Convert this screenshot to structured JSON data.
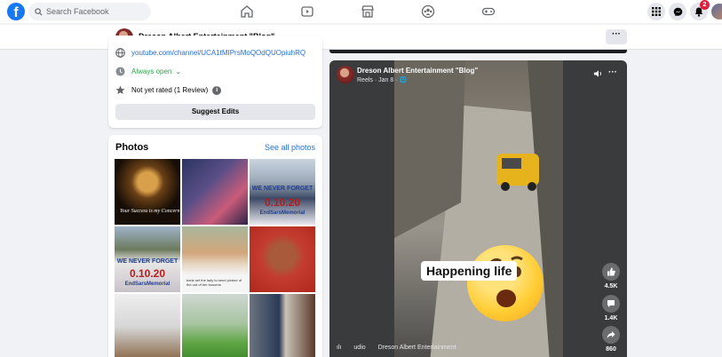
{
  "nav": {
    "logo": "f",
    "search_placeholder": "Search Facebook",
    "notification_count": "2"
  },
  "page": {
    "name": "Dreson Albert Entertainment \"Blog\"",
    "more_label": "···"
  },
  "intro": {
    "youtube_link": "youtube.com/channel/UCA1tMIPrsMoQOdQUOpiuhRQ",
    "hours": "Always open",
    "hours_chevron": "⌄",
    "rating": "Not yet rated (1 Review)",
    "info": "i",
    "suggest_edits": "Suggest Edits"
  },
  "photos": {
    "title": "Photos",
    "see_all": "See all photos",
    "captions": {
      "p1": "Your Success is my Concern",
      "p3": "WE NEVER FORGET",
      "p3b": "0.10.20",
      "p3c": "EndSarsMemorial",
      "p4": "WE NEVER FORGET",
      "p4b": "0.10.20",
      "p4c": "EndSarsMemorial",
      "p5": "bank set the lady to send picture of the out of her bosoms"
    }
  },
  "post": {
    "author": "Dreson Albert Entertainment \"Blog\"",
    "meta": "Reels · Jan 8 · 🌐",
    "more": "···",
    "overlay_text": "Happening life",
    "likes": "4.5K",
    "comments": "1.4K",
    "shares": "860",
    "audio_label": "udio",
    "audio_author": "Dreson Albert Entertainment"
  },
  "colors": {
    "brand_blue": "#1877f2",
    "link_blue": "#216fdb",
    "open_green": "#31a24c",
    "badge_red": "#e41e3f"
  }
}
